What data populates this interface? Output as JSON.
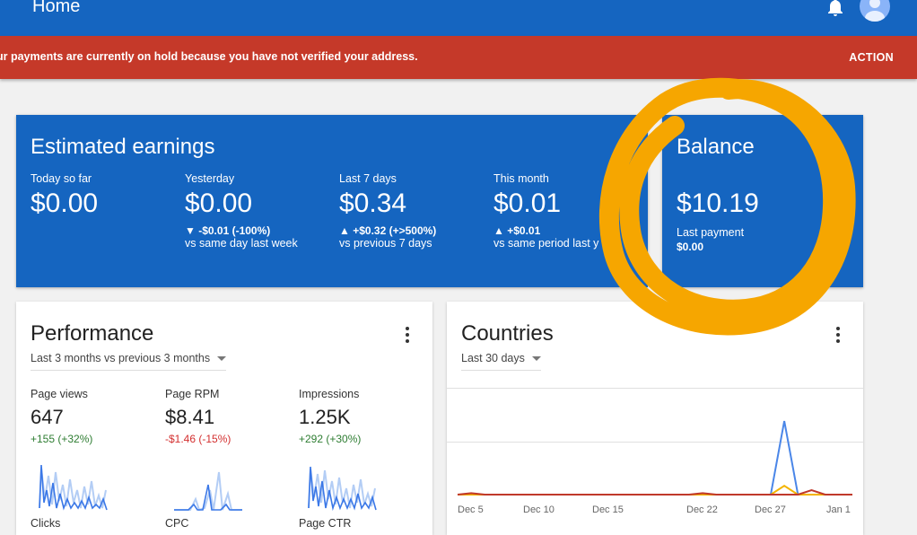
{
  "header": {
    "title": "Home",
    "icons": [
      "menu-icon",
      "notifications-icon",
      "account-avatar-icon"
    ]
  },
  "alert": {
    "message": "ur payments are currently on hold because you have not verified your address.",
    "action_label": "ACTION"
  },
  "earnings": {
    "title": "Estimated earnings",
    "metrics": [
      {
        "label": "Today so far",
        "value": "$0.00",
        "change": "",
        "comparison": ""
      },
      {
        "label": "Yesterday",
        "value": "$0.00",
        "change": "▼ -$0.01 (-100%)",
        "comparison": "vs same day last week"
      },
      {
        "label": "Last 7 days",
        "value": "$0.34",
        "change": "▲ +$0.32 (+>500%)",
        "comparison": "vs previous 7 days"
      },
      {
        "label": "This month",
        "value": "$0.01",
        "change": "▲ +$0.01",
        "comparison": "vs same period last y"
      }
    ]
  },
  "balance": {
    "title": "Balance",
    "value": "$10.19",
    "last_payment_label": "Last payment",
    "last_payment_value": "$0.00"
  },
  "performance": {
    "title": "Performance",
    "range": "Last 3 months vs previous 3 months",
    "metrics": [
      {
        "label": "Page views",
        "value": "647",
        "change": "+155 (+32%)",
        "trend": "positive"
      },
      {
        "label": "Page RPM",
        "value": "$8.41",
        "change": "-$1.46 (-15%)",
        "trend": "negative"
      },
      {
        "label": "Impressions",
        "value": "1.25K",
        "change": "+292 (+30%)",
        "trend": "positive"
      }
    ],
    "cutoff_labels": [
      "Clicks",
      "CPC",
      "Page CTR"
    ]
  },
  "countries": {
    "title": "Countries",
    "range": "Last 30 days"
  },
  "colors": {
    "brand_blue": "#1565c0",
    "alert_red": "#c53929",
    "highlight_orange": "#f6a600",
    "positive": "#2e7d32",
    "negative": "#d32f2f"
  },
  "chart_data": {
    "type": "line",
    "title": "",
    "x": [
      "Dec 5",
      "Dec 10",
      "Dec 15",
      "Dec 22",
      "Dec 27",
      "Jan 1"
    ],
    "grid": true,
    "series": [
      {
        "color": "#4a86e8",
        "values": [
          0,
          0,
          0,
          0,
          0,
          0,
          0,
          0,
          0,
          0,
          0,
          0,
          0,
          0,
          0,
          0,
          0,
          0,
          0,
          0,
          0,
          0,
          0,
          0,
          1,
          0,
          0,
          0,
          0,
          0
        ]
      },
      {
        "color": "#f4b400",
        "values": [
          0,
          0,
          0,
          0,
          0,
          0,
          0,
          0,
          0,
          0,
          0,
          0,
          0,
          0,
          0,
          0,
          0,
          0,
          0,
          0,
          0,
          0,
          0,
          0,
          0.12,
          0,
          0,
          0,
          0,
          0
        ]
      },
      {
        "color": "#c0392b",
        "values": [
          0,
          0.02,
          0,
          0,
          0,
          0,
          0,
          0,
          0,
          0,
          0,
          0,
          0,
          0,
          0,
          0,
          0,
          0,
          0.02,
          0,
          0,
          0,
          0,
          0,
          0,
          0,
          0.06,
          0,
          0,
          0
        ]
      }
    ]
  }
}
